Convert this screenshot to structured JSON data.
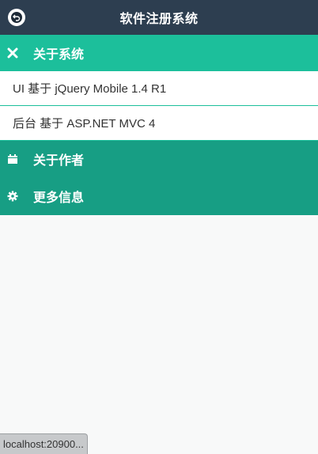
{
  "header": {
    "title": "软件注册系统",
    "back_icon": "back-arrow-icon"
  },
  "sections": [
    {
      "label": "关于系统",
      "icon": "close-icon",
      "expanded": true,
      "items": [
        "UI 基于 jQuery Mobile 1.4 R1",
        "后台 基于 ASP.NET MVC 4"
      ]
    },
    {
      "label": "关于作者",
      "icon": "calendar-icon",
      "expanded": false
    },
    {
      "label": "更多信息",
      "icon": "gear-icon",
      "expanded": false
    }
  ],
  "status_bar": {
    "text": "localhost:20900..."
  },
  "colors": {
    "header_bg": "#2d3e50",
    "active_section": "#1cbf9b",
    "section": "#179e84",
    "page_bg": "#f8f9f9"
  }
}
